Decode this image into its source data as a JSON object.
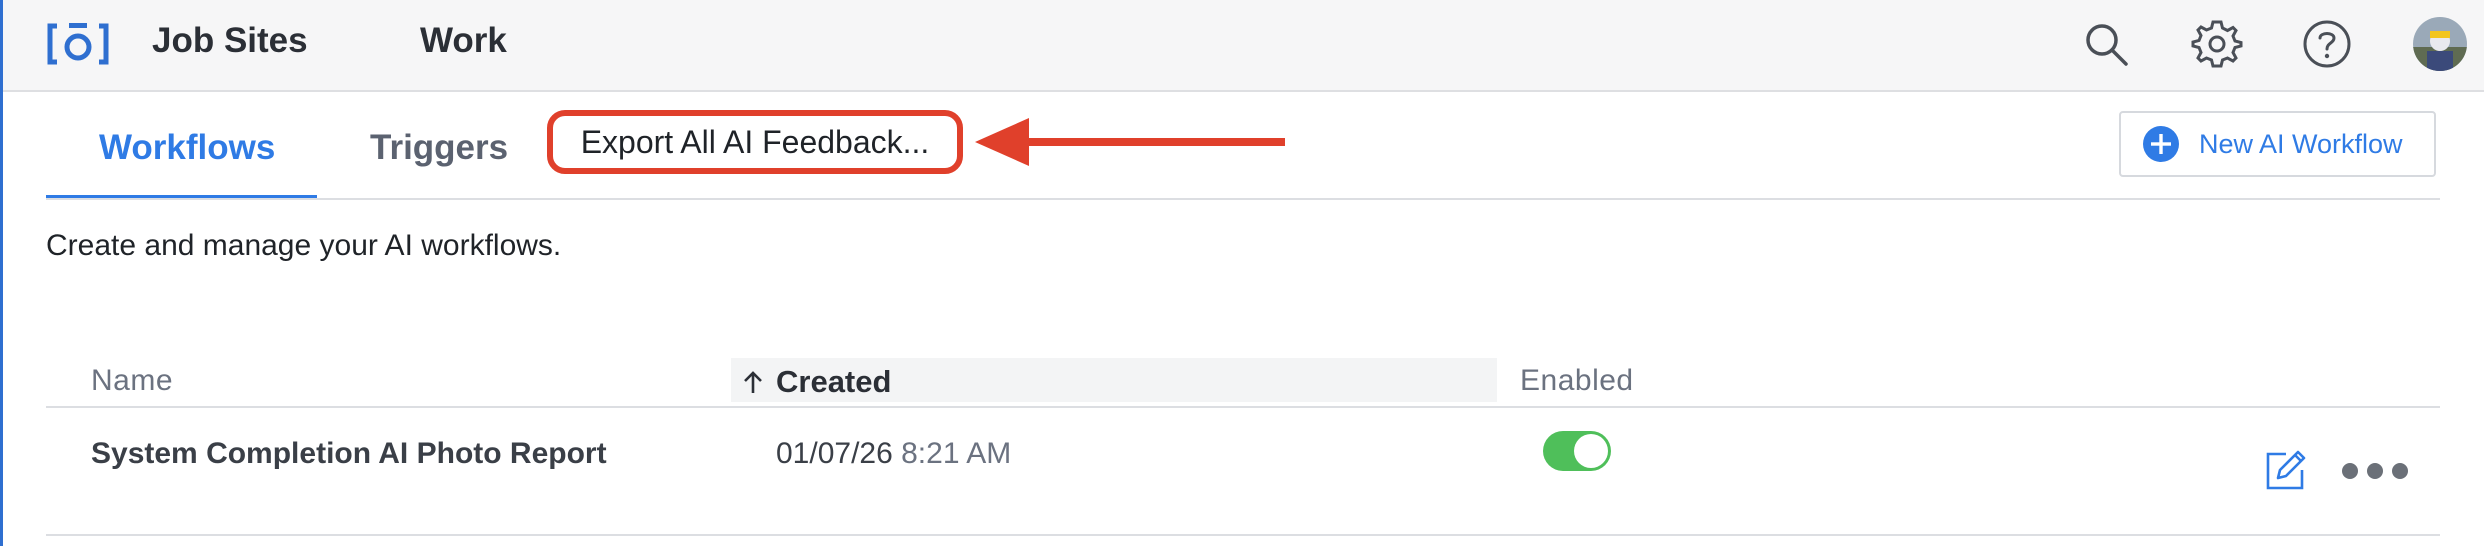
{
  "header": {
    "nav": [
      "Job Sites",
      "Work"
    ]
  },
  "tabs": {
    "workflows": "Workflows",
    "triggers": "Triggers"
  },
  "actions": {
    "export_label": "Export All AI Feedback...",
    "new_workflow_label": "New AI Workflow"
  },
  "description": "Create and manage your AI workflows.",
  "table": {
    "headers": {
      "name": "Name",
      "created": "Created",
      "enabled": "Enabled"
    },
    "rows": [
      {
        "name": "System Completion AI Photo Report",
        "date": "01/07/26",
        "time": "8:21 AM",
        "enabled": true
      }
    ]
  },
  "colors": {
    "accent": "#2f7be5",
    "toggle_on": "#4fbf5a",
    "annotation_red": "#e0402b"
  },
  "icons": [
    "logo-icon",
    "search-icon",
    "gear-icon",
    "help-icon",
    "avatar",
    "plus-circle-icon",
    "sort-up-arrow-icon",
    "edit-icon",
    "more-options-icon",
    "annotation-arrow"
  ]
}
